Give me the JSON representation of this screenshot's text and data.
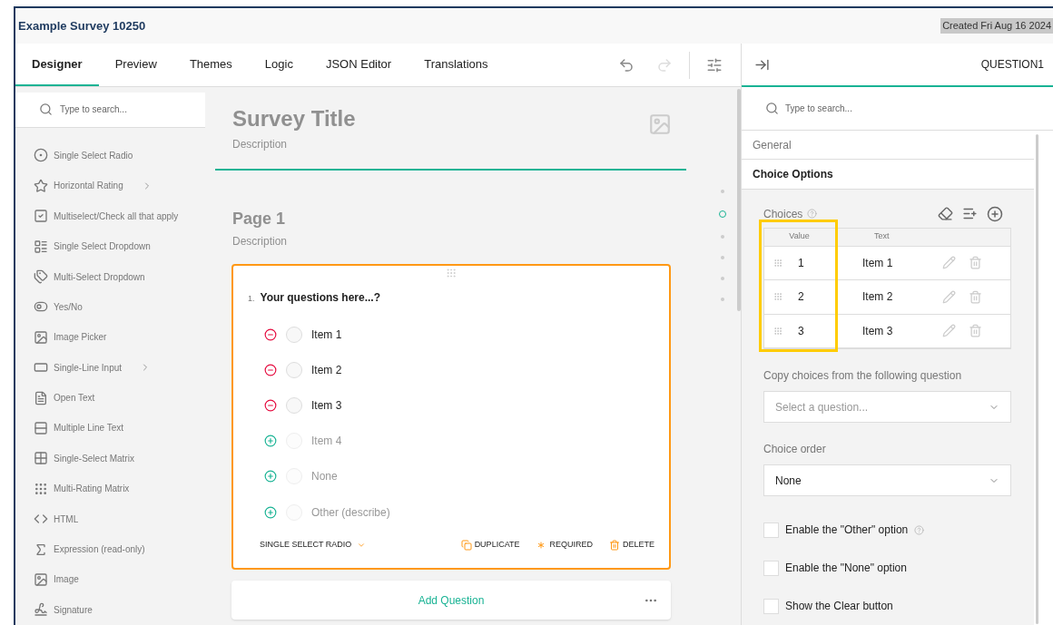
{
  "header": {
    "title": "Example Survey 10250",
    "created": "Created Fri Aug 16 2024"
  },
  "tabs": [
    {
      "label": "Designer",
      "selected": true
    },
    {
      "label": "Preview",
      "selected": false
    },
    {
      "label": "Themes",
      "selected": false
    },
    {
      "label": "Logic",
      "selected": false
    },
    {
      "label": "JSON Editor",
      "selected": false
    },
    {
      "label": "Translations",
      "selected": false
    }
  ],
  "toolbar": {
    "undo_disabled": false,
    "redo_disabled": true
  },
  "toolbox": {
    "search_placeholder": "Type to search...",
    "items": [
      {
        "label": "Single Select Radio",
        "kind": "radio",
        "has_submenu": false
      },
      {
        "label": "Horizontal Rating",
        "kind": "star",
        "has_submenu": true
      },
      {
        "label": "Multiselect/Check all that apply",
        "kind": "checkbox",
        "has_submenu": false
      },
      {
        "label": "Single Select Dropdown",
        "kind": "dropdown",
        "has_submenu": false
      },
      {
        "label": "Multi-Select Dropdown",
        "kind": "tagbox",
        "has_submenu": false
      },
      {
        "label": "Yes/No",
        "kind": "toggle",
        "has_submenu": false
      },
      {
        "label": "Image Picker",
        "kind": "imagepicker",
        "has_submenu": false
      },
      {
        "label": "Single-Line Input",
        "kind": "input",
        "has_submenu": true
      },
      {
        "label": "Open Text",
        "kind": "text",
        "has_submenu": false
      },
      {
        "label": "Multiple Line Text",
        "kind": "multitext",
        "has_submenu": false
      },
      {
        "label": "Single-Select Matrix",
        "kind": "matrix",
        "has_submenu": false
      },
      {
        "label": "Multi-Rating Matrix",
        "kind": "dots",
        "has_submenu": false
      },
      {
        "label": "HTML",
        "kind": "code",
        "has_submenu": false
      },
      {
        "label": "Expression (read-only)",
        "kind": "function",
        "has_submenu": false
      },
      {
        "label": "Image",
        "kind": "image",
        "has_submenu": false
      },
      {
        "label": "Signature",
        "kind": "signature",
        "has_submenu": false
      }
    ]
  },
  "survey": {
    "title": "Survey Title",
    "description": "Description",
    "page_title": "Page 1",
    "page_description": "Description",
    "question": {
      "number": "1.",
      "title": "Your questions here...?",
      "choices": [
        {
          "label": "Item 1",
          "kind": "existing"
        },
        {
          "label": "Item 2",
          "kind": "existing"
        },
        {
          "label": "Item 3",
          "kind": "existing"
        },
        {
          "label": "Item 4",
          "kind": "placeholder"
        },
        {
          "label": "None",
          "kind": "placeholder"
        },
        {
          "label": "Other (describe)",
          "kind": "placeholder"
        }
      ],
      "type": "SINGLE SELECT RADIO",
      "actions": [
        {
          "label": "DUPLICATE",
          "kind": "duplicate"
        },
        {
          "label": "REQUIRED",
          "kind": "required"
        },
        {
          "label": "DELETE",
          "kind": "delete"
        }
      ]
    },
    "add_question": "Add Question"
  },
  "page_navigator": [
    {
      "selected": false
    },
    {
      "selected": true
    },
    {
      "selected": false
    },
    {
      "selected": false
    },
    {
      "selected": false
    },
    {
      "selected": false
    }
  ],
  "property_grid": {
    "title": "QUESTION1",
    "search_placeholder": "Type to search...",
    "categories": [
      {
        "label": "General",
        "expanded": false
      },
      {
        "label": "Choice Options",
        "expanded": true
      }
    ],
    "choices_label": "Choices",
    "columns": [
      "Value",
      "Text"
    ],
    "value_column_highlighted": true,
    "rows": [
      {
        "value": "1",
        "text": "Item 1"
      },
      {
        "value": "2",
        "text": "Item 2"
      },
      {
        "value": "3",
        "text": "Item 3"
      }
    ],
    "copy_label": "Copy choices from the following question",
    "copy_placeholder": "Select a question...",
    "order_label": "Choice order",
    "order_value": "None",
    "checkboxes": [
      {
        "label": "Enable the \"Other\" option",
        "checked": false,
        "has_help": true
      },
      {
        "label": "Enable the \"None\" option",
        "checked": false,
        "has_help": false
      },
      {
        "label": "Show the Clear button",
        "checked": false,
        "has_help": false
      }
    ]
  }
}
